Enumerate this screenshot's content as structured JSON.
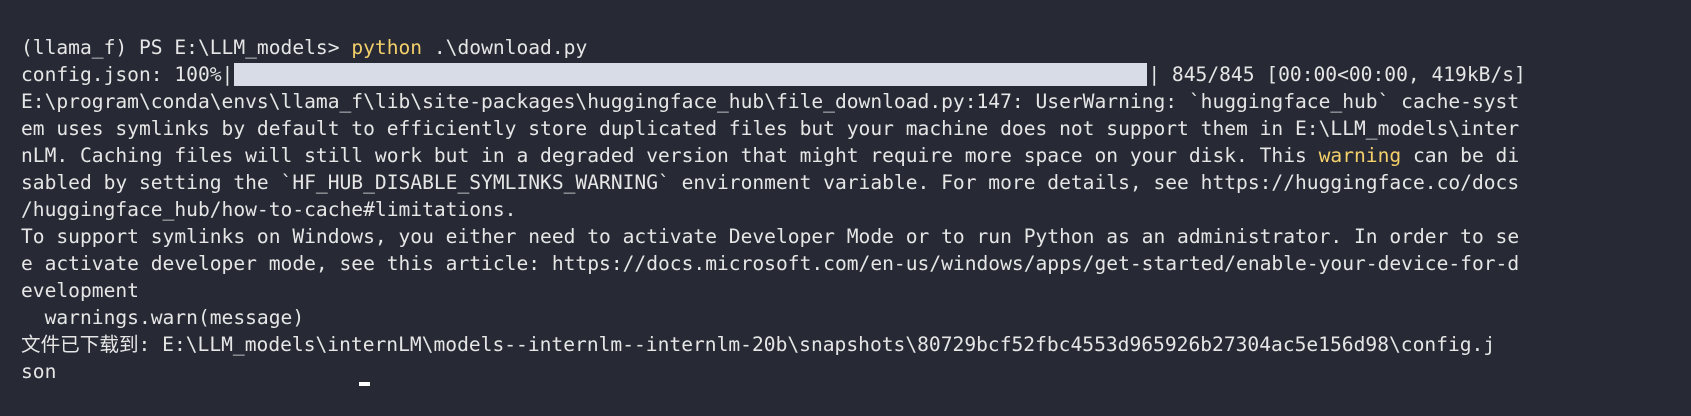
{
  "terminal": {
    "prompt": "(llama_f) PS E:\\LLM_models> ",
    "command": "python",
    "command_args": " .\\download.py",
    "progress": {
      "label": "config.json: 100%|",
      "fraction": 1.0,
      "suffix": "| 845/845 [00:00<00:00, 419kB/s]"
    },
    "warning": {
      "l1": "E:\\program\\conda\\envs\\llama_f\\lib\\site-packages\\huggingface_hub\\file_download.py:147: UserWarning: `huggingface_hub` cache-syst",
      "l2": "em uses symlinks by default to efficiently store duplicated files but your machine does not support them in E:\\LLM_models\\inter",
      "l3_pre": "nLM. Caching files will still work but in a degraded version that might require more space on your disk. This ",
      "l3_word": "warning",
      "l3_post": " can be di",
      "l4": "sabled by setting the `HF_HUB_DISABLE_SYMLINKS_WARNING` environment variable. For more details, see https://huggingface.co/docs",
      "l5": "/huggingface_hub/how-to-cache#limitations."
    },
    "symlink_note": {
      "l1": "To support symlinks on Windows, you either need to activate Developer Mode or to run Python as an administrator. In order to se",
      "l2": "e activate developer mode, see this article: https://docs.microsoft.com/en-us/windows/apps/get-started/enable-your-device-for-d",
      "l3": "evelopment"
    },
    "warn_call": "  warnings.warn(message)",
    "result": {
      "l1": "文件已下载到: E:\\LLM_models\\internLM\\models--internlm--internlm-20b\\snapshots\\80729bcf52fbc4553d965926b27304ac5e156d98\\config.j",
      "l2": "son"
    }
  }
}
